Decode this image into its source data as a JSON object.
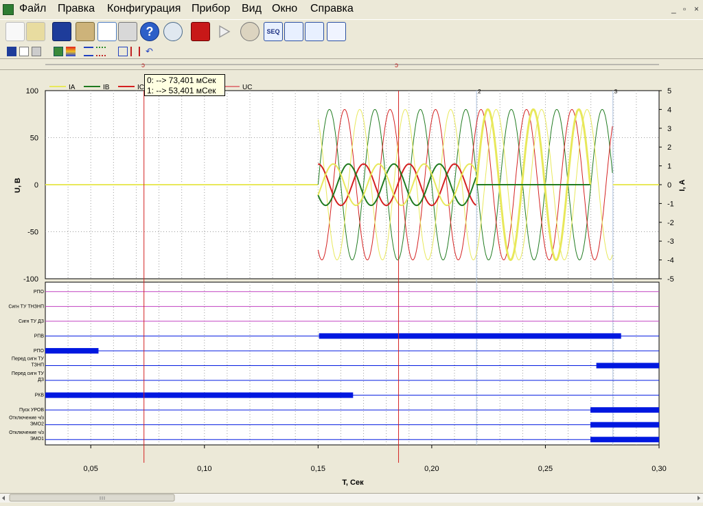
{
  "menu": [
    "Файл",
    "Правка",
    "Конфигурация",
    "Прибор",
    "Вид",
    "Окно",
    "Справка"
  ],
  "window_buttons": [
    "_",
    "▫",
    "×"
  ],
  "toolbar_icons": [
    "new-icon",
    "open-icon",
    "save-icon",
    "properties-icon",
    "preview-icon",
    "print-icon",
    "help-icon",
    "zoom-icon",
    "record-icon",
    "play-icon",
    "analyze-icon",
    "seq-icon",
    "chart-icon",
    "table-icon",
    "grid-icon"
  ],
  "toolbar_seq_label": "SEQ",
  "toolbar2_icons": [
    "save-small-icon",
    "copy-icon",
    "print-small-icon",
    "export-icon",
    "color-icon",
    "lines-icon",
    "waves-icon",
    "fit-icon",
    "zoom-h-icon",
    "undo-icon"
  ],
  "tooltip": {
    "line0": "0: --> 73,401 мСек",
    "line1": "1: --> 53,401 мСек"
  },
  "colors": {
    "IA": "#e8e85a",
    "IB": "#1f7a1f",
    "IC": "#d42020",
    "UC": "#e08080",
    "discrete": "#0018e0",
    "cursor": "#d42020",
    "purple": "#c040c0"
  },
  "chart_data": {
    "type": "line",
    "legend": [
      "IA",
      "IB",
      "IC",
      "UC"
    ],
    "ylabel_left": "U, В",
    "ylabel_right": "I, А",
    "xlabel": "T, Сек",
    "ylim_left": [
      -100,
      100
    ],
    "ylim_right": [
      -5,
      5
    ],
    "xlim": [
      0.03,
      0.3
    ],
    "yticks_left": [
      "100",
      "50",
      "0",
      "-50",
      "-100"
    ],
    "yticks_right": [
      "5",
      "4",
      "3",
      "2",
      "1",
      "0",
      "-1",
      "-2",
      "-3",
      "-4",
      "-5"
    ],
    "xticks": [
      "0,05",
      "0,10",
      "0,15",
      "0,20",
      "0,25",
      "0,30"
    ],
    "xtick_values": [
      0.05,
      0.1,
      0.15,
      0.2,
      0.25,
      0.3
    ],
    "cursors": [
      0.0734,
      0.1854
    ],
    "markers": [
      {
        "label": "2",
        "x": 0.2197
      },
      {
        "label": "3",
        "x": 0.2797
      }
    ],
    "signal_frequency_hz": 50,
    "voltage_amplitude": 80,
    "current_amplitude_small": 1.1,
    "current_amplitude_large": 4.0,
    "fault_start": 0.15,
    "trip_time": 0.2197,
    "end_time": 0.2797,
    "discrete": [
      {
        "name": "РПО",
        "bars": []
      },
      {
        "name": "Сигн ТУ ТНЗНП",
        "bars": []
      },
      {
        "name": "Сигн ТУ ДЗ",
        "bars": []
      },
      {
        "name": "РПВ",
        "bars": [
          [
            0.1504,
            0.2833
          ]
        ]
      },
      {
        "name": "РПО",
        "bars": [
          [
            0.03,
            0.0534
          ]
        ]
      },
      {
        "name": "Перед сигн ТУ ТЗНП",
        "bars": [
          [
            0.2724,
            0.3
          ]
        ]
      },
      {
        "name": "Перед сигн ТУ ДЗ",
        "bars": []
      },
      {
        "name": "РКВ",
        "bars": [
          [
            0.03,
            0.1654
          ]
        ]
      },
      {
        "name": "Пуск УРОВ",
        "bars": [
          [
            0.2698,
            0.3
          ]
        ]
      },
      {
        "name": "Отключение ч/з ЭМО2",
        "bars": [
          [
            0.2698,
            0.3
          ]
        ]
      },
      {
        "name": "Отключение ч/з ЭМО1",
        "bars": [
          [
            0.2698,
            0.3
          ]
        ]
      }
    ]
  }
}
